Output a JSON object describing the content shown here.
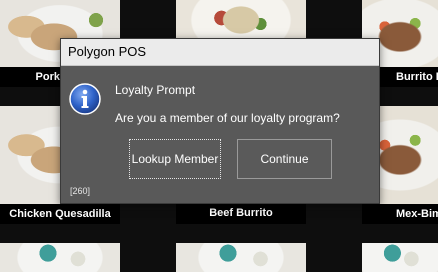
{
  "menu": {
    "items": [
      {
        "name": "Pork Quesadilla"
      },
      {
        "name": ""
      },
      {
        "name": "Burrito Bowl"
      },
      {
        "name": "Chicken Quesadilla"
      },
      {
        "name": "Beef Burrito"
      },
      {
        "name": "Mex-Bim-Bap"
      },
      {
        "name": ""
      },
      {
        "name": ""
      },
      {
        "name": ""
      }
    ]
  },
  "captions": {
    "row1_left": "Pork Que",
    "row1_right": "Burrito B",
    "row2_left": "Chicken Quesadilla",
    "row2_mid": "Beef Burrito",
    "row2_right": "Mex-Bim-"
  },
  "dialog": {
    "window_title": "Polygon POS",
    "icon": "info-icon",
    "prompt_title": "Loyalty Prompt",
    "message": "Are you a member of our loyalty program?",
    "lookup_label": "Lookup Member",
    "continue_label": "Continue",
    "code": "[260]"
  },
  "colors": {
    "dialog_bg": "#595959",
    "titlebar_bg": "#ebebeb",
    "icon_blue": "#2f63c9"
  }
}
